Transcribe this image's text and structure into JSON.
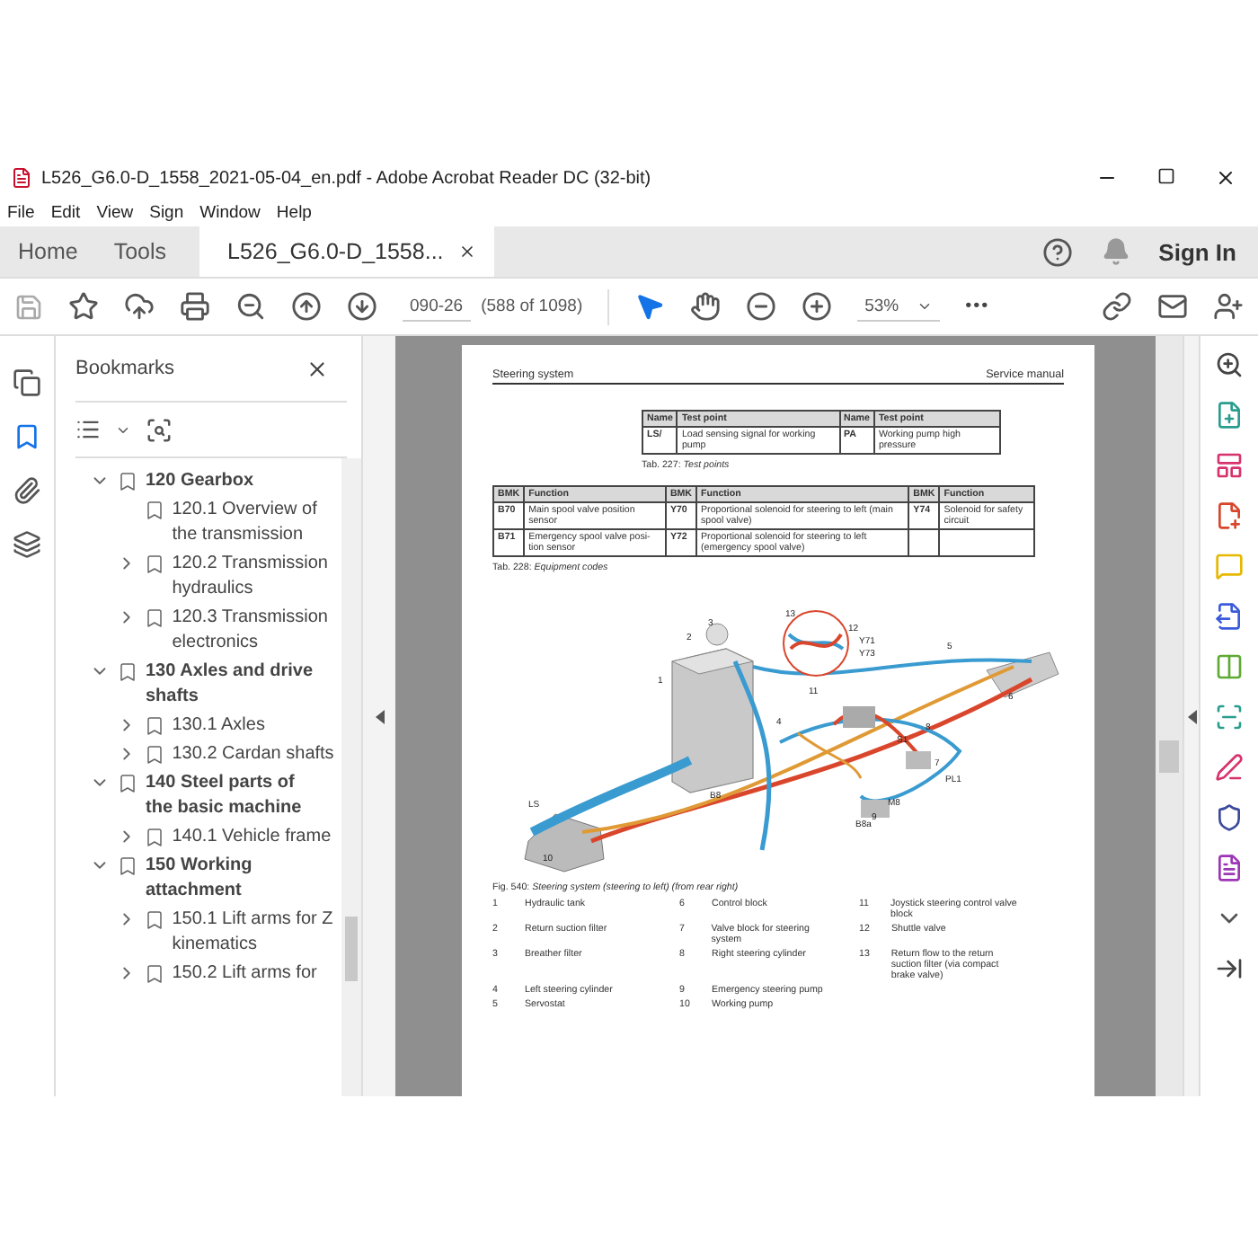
{
  "window": {
    "title": "L526_G6.0-D_1558_2021-05-04_en.pdf - Adobe Acrobat Reader DC (32-bit)"
  },
  "menu": [
    "File",
    "Edit",
    "View",
    "Sign",
    "Window",
    "Help"
  ],
  "tabs": [
    {
      "label": "Home",
      "selected": false,
      "closable": false
    },
    {
      "label": "Tools",
      "selected": false,
      "closable": false
    },
    {
      "label": "L526_G6.0-D_1558...",
      "selected": true,
      "closable": true
    }
  ],
  "account": {
    "sign_in": "Sign In"
  },
  "toolbar": {
    "page": "090-26",
    "page_count": "(588 of 1098)",
    "zoom": "53%",
    "more": "•••"
  },
  "left_rail": [
    {
      "kind": "pages",
      "selected": false
    },
    {
      "kind": "bookmarks",
      "selected": true
    },
    {
      "kind": "attachments",
      "selected": false
    },
    {
      "kind": "layers",
      "selected": false
    }
  ],
  "bookmarks": {
    "title": "Bookmarks",
    "items": [
      {
        "label": "120 Gearbox",
        "kind": "branch",
        "expanded": true,
        "children": [
          {
            "label": "120.1 Overview of the transmission",
            "kind": "leaf"
          },
          {
            "label": "120.2 Transmission hydraulics",
            "kind": "branch",
            "expanded": false
          },
          {
            "label": "120.3 Transmission electronics",
            "kind": "branch",
            "expanded": false
          }
        ]
      },
      {
        "label": "130 Axles and drive shafts",
        "kind": "branch",
        "expanded": true,
        "children": [
          {
            "label": "130.1 Axles",
            "kind": "branch",
            "expanded": false
          },
          {
            "label": "130.2 Cardan shafts",
            "kind": "branch",
            "expanded": false
          }
        ]
      },
      {
        "label": "140 Steel parts of the basic machine",
        "kind": "branch",
        "expanded": true,
        "children": [
          {
            "label": "140.1 Vehicle frame",
            "kind": "branch",
            "expanded": false
          }
        ]
      },
      {
        "label": "150 Working attachment",
        "kind": "branch",
        "expanded": true,
        "children": [
          {
            "label": "150.1 Lift arms for Z kinematics",
            "kind": "branch",
            "expanded": false
          },
          {
            "label": "150.2 Lift arms for",
            "kind": "branch",
            "expanded": false
          }
        ]
      }
    ]
  },
  "document": {
    "page_header": {
      "section": "Steering system",
      "manual": "Service manual"
    },
    "test_points": {
      "columns": [
        "Name",
        "Test point",
        "Name",
        "Test point"
      ],
      "rows": [
        [
          "LS/",
          "Load sensing signal for working pump",
          "PA",
          "Working pump high pressure"
        ]
      ],
      "caption": "Tab. 227: *Test points*"
    },
    "equipment_codes": {
      "columns": [
        "BMK",
        "Function",
        "BMK",
        "Function",
        "BMK",
        "Function"
      ],
      "rows": [
        [
          "B70",
          "Main spool valve position sensor",
          "Y70",
          "Proportional solenoid for steering to left (main spool valve)",
          "Y74",
          "Solenoid for safety circuit"
        ],
        [
          "B71",
          "Emergency spool valve posi- tion sensor",
          "Y72",
          "Proportional solenoid for steering to left (emergency spool valve)"
        ]
      ],
      "caption": "Tab. 228: *Equipment codes*"
    },
    "figure": {
      "callouts": [
        "13",
        "12",
        "Y71",
        "Y73",
        "11",
        "3",
        "2",
        "1",
        "5",
        "6",
        "4",
        "8",
        "S1",
        "7",
        "PL1",
        "M8",
        "B8",
        "9",
        "B8a",
        "LS",
        "10"
      ],
      "caption": "Fig. 540: *Steering system (steering to left) (from rear right)*",
      "legend": [
        {
          "number": "1",
          "text": "Hydraulic tank"
        },
        {
          "number": "2",
          "text": "Return suction filter"
        },
        {
          "number": "3",
          "text": "Breather filter"
        },
        {
          "number": "4",
          "text": "Left steering cylinder"
        },
        {
          "number": "5",
          "text": "Servostat"
        },
        {
          "number": "6",
          "text": "Control block"
        },
        {
          "number": "7",
          "text": "Valve block for steering system"
        },
        {
          "number": "8",
          "text": "Right steering cylinder"
        },
        {
          "number": "9",
          "text": "Emergency steering pump"
        },
        {
          "number": "10",
          "text": "Working pump"
        },
        {
          "number": "11",
          "text": "Joystick steering control valve block"
        },
        {
          "number": "12",
          "text": "Shuttle valve"
        },
        {
          "number": "13",
          "text": "Return flow to the return suction filter (via compact brake valve)"
        }
      ]
    }
  }
}
